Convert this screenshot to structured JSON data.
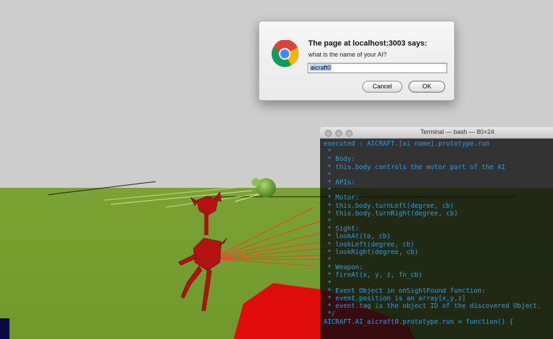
{
  "dialog": {
    "title": "The page at localhost:3003 says:",
    "message": "what is the name of your AI?",
    "input_value": "aicraft0",
    "cancel_label": "Cancel",
    "ok_label": "OK",
    "logo_icon": "chrome-logo-icon"
  },
  "terminal": {
    "title": "Terminal — bash — 80×24",
    "text_color": "#2c9ee6",
    "lines": [
      "executed : AICRAFT.[ai name].prototype.run",
      " *",
      " * Body:",
      " * this.body controls the motor part of the AI",
      " *",
      " * APIs:",
      " *",
      " * Motor:",
      " * this.body.turnLeft(degree, cb)",
      " * this.body.turnRight(degree, cb)",
      " *",
      " * Sight:",
      " * lookAt(to, cb)",
      " * lookLeft(degree, cb)",
      " * lookRight(degree, cb)",
      " *",
      " * Weapon:",
      " * fireAt(x, y, z, fn_cb)",
      " *",
      " * Event Object in onSightFound function:",
      " * event.position is an array[x,y,z]",
      " * event.tag is the object ID of the discovered Object.",
      " */",
      "AICRAFT.AI_aicraft0.prototype.run = function() {"
    ]
  },
  "scene": {
    "sky_color": "#cdcdcd",
    "ground_color": "#7ba232",
    "robot_color": "#b41212",
    "sphere_color": "#6fae2c",
    "laser_color": "#e0502a"
  }
}
